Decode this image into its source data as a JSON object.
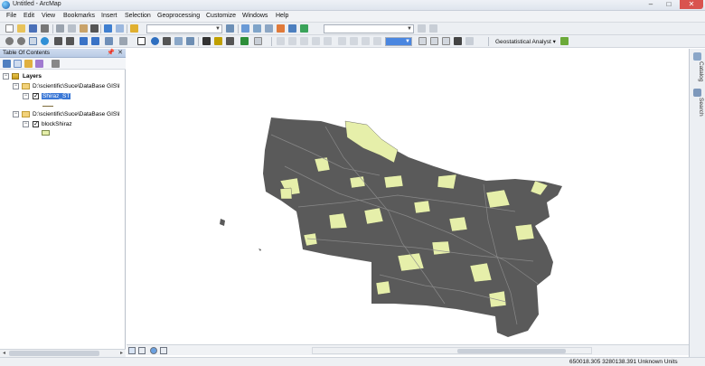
{
  "window": {
    "title": "Untitled - ArcMap",
    "minimize": "–",
    "maximize": "□",
    "close": "✕"
  },
  "menu": {
    "items": [
      "File",
      "Edit",
      "View",
      "Bookmarks",
      "Insert",
      "Selection",
      "Geoprocessing",
      "Customize",
      "Windows",
      "Help"
    ]
  },
  "toolbar": {
    "geostatistical_label": "Geostatistical Analyst ▾",
    "scale_combo_value": "",
    "layer_combo_value": ""
  },
  "toc": {
    "title": "Table Of Contents",
    "pin": "📌",
    "close": "✕",
    "root_label": "Layers",
    "groups": [
      {
        "path_label": "D:\\scientific\\Suce\\DataBase GIS\\l",
        "layer_label": "Shiraz_ST",
        "selected": true,
        "symbol": "line"
      },
      {
        "path_label": "D:\\scientific\\Suce\\DataBase GIS\\l",
        "layer_label": "blockShiraz",
        "selected": false,
        "symbol": "polygon"
      }
    ]
  },
  "map": {
    "fill_color": "#5a5a5a",
    "highlight_color": "#e6efaa",
    "background": "#ffffff"
  },
  "right_panel": {
    "tabs": [
      "Catalog",
      "Search"
    ]
  },
  "status": {
    "coordinates": "650018.305  3280138.391 Unknown Units"
  },
  "colors": {
    "selection": "#3b78d6",
    "title_gradient_top": "#eef1f6"
  }
}
